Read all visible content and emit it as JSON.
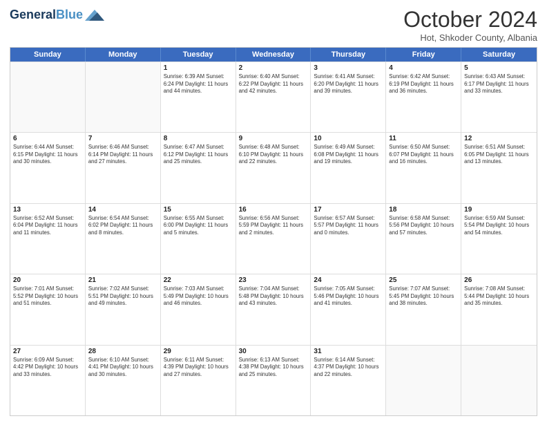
{
  "header": {
    "logo_general": "General",
    "logo_blue": "Blue",
    "month_title": "October 2024",
    "location": "Hot, Shkoder County, Albania"
  },
  "days_of_week": [
    "Sunday",
    "Monday",
    "Tuesday",
    "Wednesday",
    "Thursday",
    "Friday",
    "Saturday"
  ],
  "weeks": [
    [
      {
        "day": "",
        "info": ""
      },
      {
        "day": "",
        "info": ""
      },
      {
        "day": "1",
        "info": "Sunrise: 6:39 AM\nSunset: 6:24 PM\nDaylight: 11 hours and 44 minutes."
      },
      {
        "day": "2",
        "info": "Sunrise: 6:40 AM\nSunset: 6:22 PM\nDaylight: 11 hours and 42 minutes."
      },
      {
        "day": "3",
        "info": "Sunrise: 6:41 AM\nSunset: 6:20 PM\nDaylight: 11 hours and 39 minutes."
      },
      {
        "day": "4",
        "info": "Sunrise: 6:42 AM\nSunset: 6:19 PM\nDaylight: 11 hours and 36 minutes."
      },
      {
        "day": "5",
        "info": "Sunrise: 6:43 AM\nSunset: 6:17 PM\nDaylight: 11 hours and 33 minutes."
      }
    ],
    [
      {
        "day": "6",
        "info": "Sunrise: 6:44 AM\nSunset: 6:15 PM\nDaylight: 11 hours and 30 minutes."
      },
      {
        "day": "7",
        "info": "Sunrise: 6:46 AM\nSunset: 6:14 PM\nDaylight: 11 hours and 27 minutes."
      },
      {
        "day": "8",
        "info": "Sunrise: 6:47 AM\nSunset: 6:12 PM\nDaylight: 11 hours and 25 minutes."
      },
      {
        "day": "9",
        "info": "Sunrise: 6:48 AM\nSunset: 6:10 PM\nDaylight: 11 hours and 22 minutes."
      },
      {
        "day": "10",
        "info": "Sunrise: 6:49 AM\nSunset: 6:08 PM\nDaylight: 11 hours and 19 minutes."
      },
      {
        "day": "11",
        "info": "Sunrise: 6:50 AM\nSunset: 6:07 PM\nDaylight: 11 hours and 16 minutes."
      },
      {
        "day": "12",
        "info": "Sunrise: 6:51 AM\nSunset: 6:05 PM\nDaylight: 11 hours and 13 minutes."
      }
    ],
    [
      {
        "day": "13",
        "info": "Sunrise: 6:52 AM\nSunset: 6:04 PM\nDaylight: 11 hours and 11 minutes."
      },
      {
        "day": "14",
        "info": "Sunrise: 6:54 AM\nSunset: 6:02 PM\nDaylight: 11 hours and 8 minutes."
      },
      {
        "day": "15",
        "info": "Sunrise: 6:55 AM\nSunset: 6:00 PM\nDaylight: 11 hours and 5 minutes."
      },
      {
        "day": "16",
        "info": "Sunrise: 6:56 AM\nSunset: 5:59 PM\nDaylight: 11 hours and 2 minutes."
      },
      {
        "day": "17",
        "info": "Sunrise: 6:57 AM\nSunset: 5:57 PM\nDaylight: 11 hours and 0 minutes."
      },
      {
        "day": "18",
        "info": "Sunrise: 6:58 AM\nSunset: 5:56 PM\nDaylight: 10 hours and 57 minutes."
      },
      {
        "day": "19",
        "info": "Sunrise: 6:59 AM\nSunset: 5:54 PM\nDaylight: 10 hours and 54 minutes."
      }
    ],
    [
      {
        "day": "20",
        "info": "Sunrise: 7:01 AM\nSunset: 5:52 PM\nDaylight: 10 hours and 51 minutes."
      },
      {
        "day": "21",
        "info": "Sunrise: 7:02 AM\nSunset: 5:51 PM\nDaylight: 10 hours and 49 minutes."
      },
      {
        "day": "22",
        "info": "Sunrise: 7:03 AM\nSunset: 5:49 PM\nDaylight: 10 hours and 46 minutes."
      },
      {
        "day": "23",
        "info": "Sunrise: 7:04 AM\nSunset: 5:48 PM\nDaylight: 10 hours and 43 minutes."
      },
      {
        "day": "24",
        "info": "Sunrise: 7:05 AM\nSunset: 5:46 PM\nDaylight: 10 hours and 41 minutes."
      },
      {
        "day": "25",
        "info": "Sunrise: 7:07 AM\nSunset: 5:45 PM\nDaylight: 10 hours and 38 minutes."
      },
      {
        "day": "26",
        "info": "Sunrise: 7:08 AM\nSunset: 5:44 PM\nDaylight: 10 hours and 35 minutes."
      }
    ],
    [
      {
        "day": "27",
        "info": "Sunrise: 6:09 AM\nSunset: 4:42 PM\nDaylight: 10 hours and 33 minutes."
      },
      {
        "day": "28",
        "info": "Sunrise: 6:10 AM\nSunset: 4:41 PM\nDaylight: 10 hours and 30 minutes."
      },
      {
        "day": "29",
        "info": "Sunrise: 6:11 AM\nSunset: 4:39 PM\nDaylight: 10 hours and 27 minutes."
      },
      {
        "day": "30",
        "info": "Sunrise: 6:13 AM\nSunset: 4:38 PM\nDaylight: 10 hours and 25 minutes."
      },
      {
        "day": "31",
        "info": "Sunrise: 6:14 AM\nSunset: 4:37 PM\nDaylight: 10 hours and 22 minutes."
      },
      {
        "day": "",
        "info": ""
      },
      {
        "day": "",
        "info": ""
      }
    ]
  ]
}
